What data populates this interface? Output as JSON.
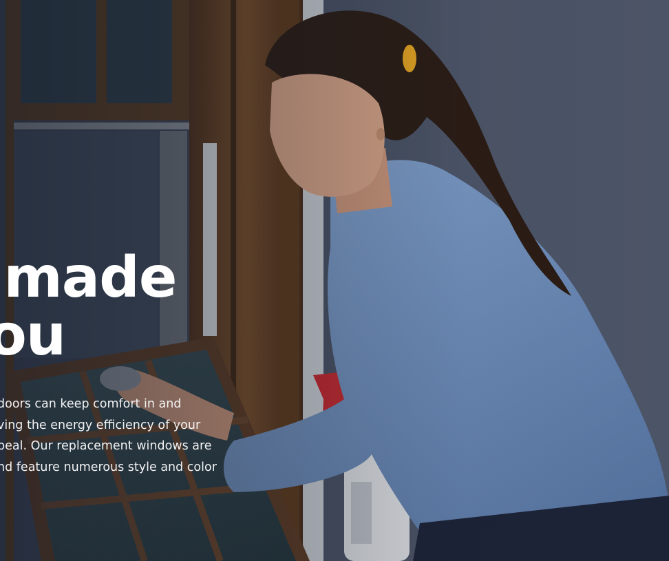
{
  "hero": {
    "headline_lines": [
      "s made",
      "you"
    ],
    "body_lines": [
      "doors can keep comfort in and",
      "ving the energy efficiency of your",
      "peal. Our replacement windows are",
      "nd feature numerous style and color"
    ]
  },
  "colors": {
    "wall": "#4a5366",
    "shirt": "#6f8fbd",
    "wood": "#6b4322",
    "text": "#ffffff"
  }
}
